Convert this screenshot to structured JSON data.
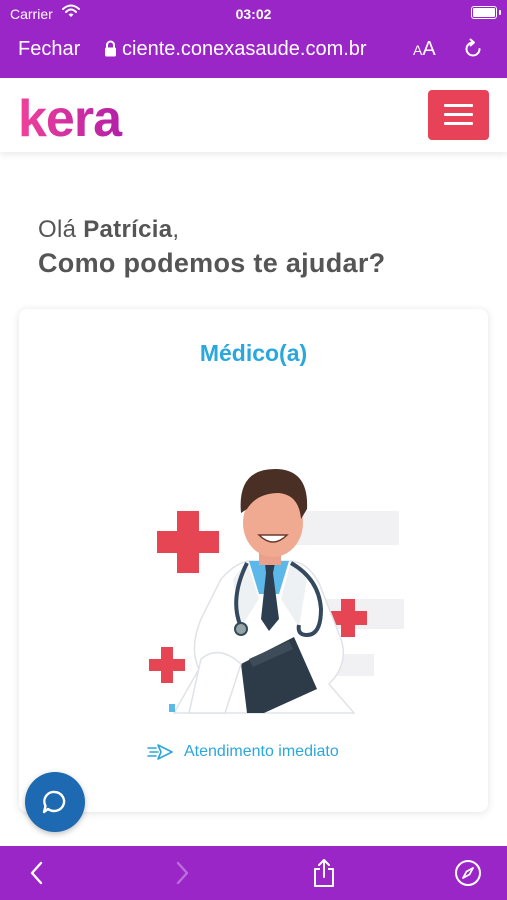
{
  "status_bar": {
    "carrier": "Carrier",
    "time": "03:02"
  },
  "browser": {
    "close_label": "Fechar",
    "url": "ciente.conexasaude.com.br",
    "text_size_small": "A",
    "text_size_large": "A"
  },
  "header": {
    "logo_text": "kera"
  },
  "main": {
    "greeting_prefix": "Olá",
    "user_name": "Patrícia",
    "greeting_suffix": ",",
    "question": "Como podemos te ajudar?"
  },
  "card": {
    "title": "Médico(a)",
    "service_label": "Atendimento imediato"
  },
  "colors": {
    "browser_purple": "#9b26c8",
    "menu_red": "#e84258",
    "accent_blue": "#2aa7dc",
    "chat_blue": "#1d69b2",
    "text_gray": "#555555"
  },
  "icons": [
    "wifi-icon",
    "battery-icon",
    "lock-icon",
    "reload-icon",
    "hamburger-icon",
    "arrow-right-icon",
    "chat-bubble-icon",
    "back-icon",
    "forward-icon",
    "share-icon",
    "compass-icon"
  ]
}
